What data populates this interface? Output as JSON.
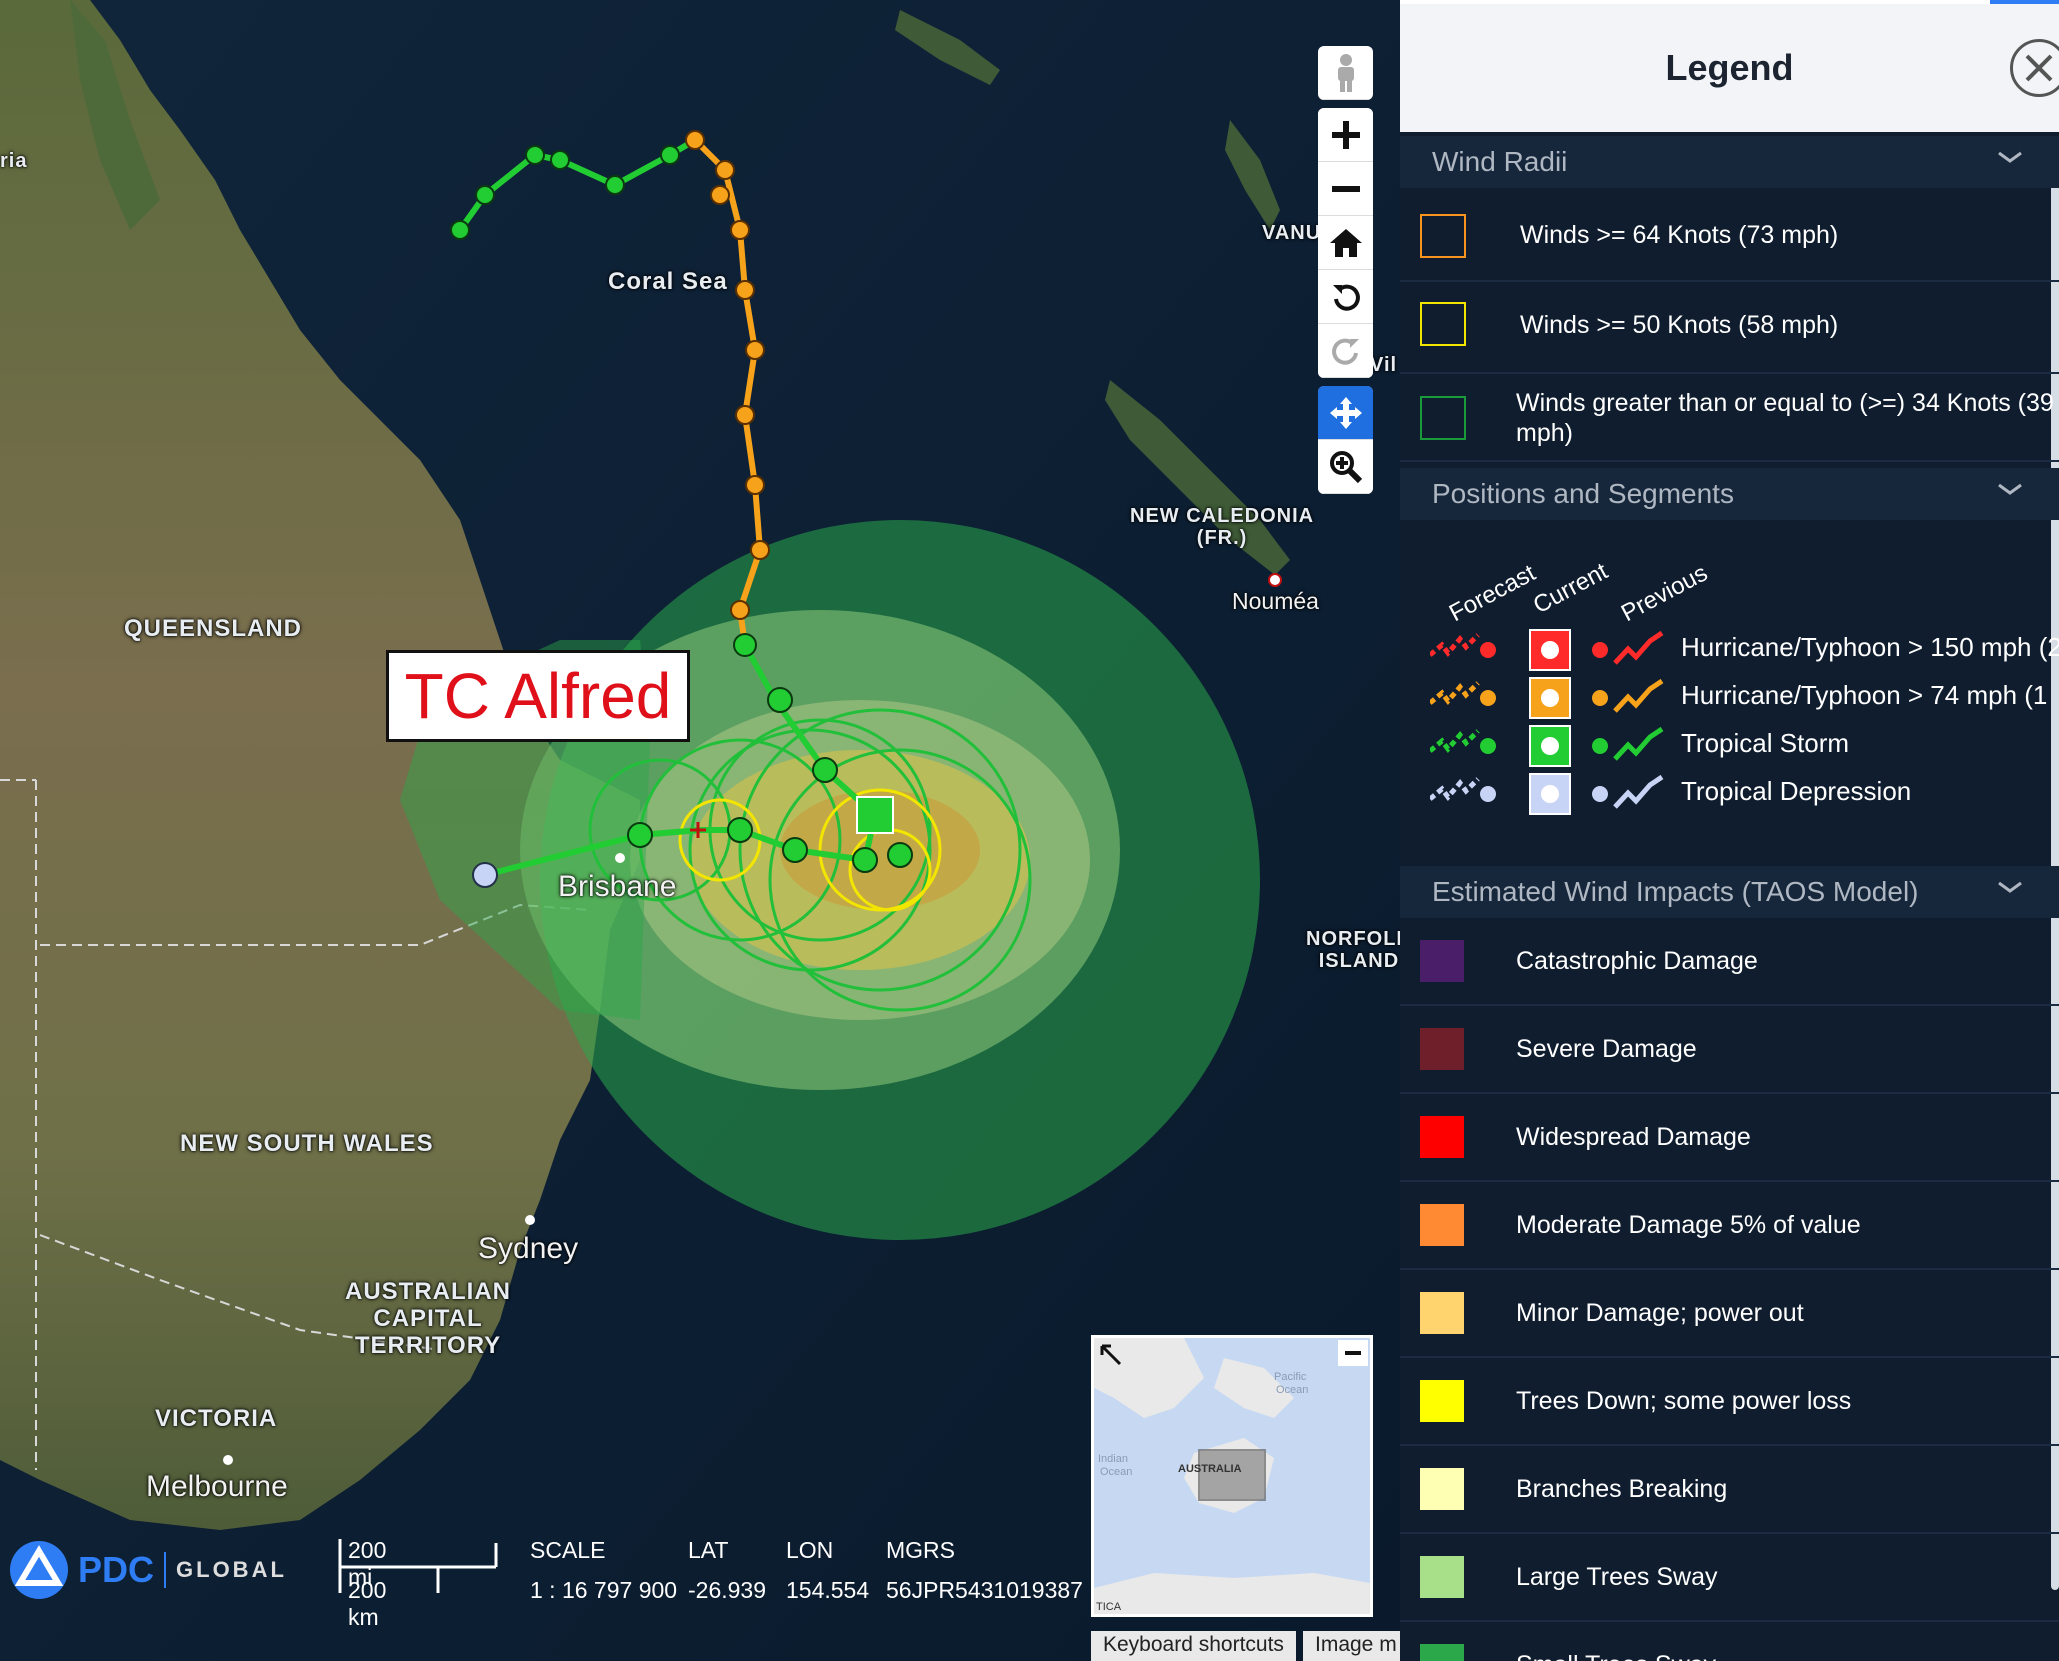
{
  "map": {
    "region_labels": {
      "queensland": "QUEENSLAND",
      "new_south_wales": "NEW SOUTH WALES",
      "act": [
        "AUSTRALIAN",
        "CAPITAL",
        "TERRITORY"
      ],
      "victoria": "VICTORIA",
      "new_caledonia": [
        "NEW CALEDONIA",
        "(FR.)"
      ],
      "norfolk_island": [
        "NORFOLK",
        "ISLAND"
      ],
      "vanuatu": "VANUATU",
      "coral_sea": "Coral Sea",
      "australia_edge": "ria",
      "vi_edge": "Vil"
    },
    "city_labels": {
      "brisbane": "Brisbane",
      "sydney": "Sydney",
      "melbourne": "Melbourne",
      "noumea": "Nouméa"
    },
    "storm_label": "TC Alfred"
  },
  "toolbar": {
    "street_view": "street-view-icon",
    "zoom_in": "plus-icon",
    "zoom_out": "minus-icon",
    "home": "home-icon",
    "rotate_left": "rotate-left-icon",
    "rotate_right": "rotate-right-icon",
    "pan": "pan-icon",
    "zoom_box": "magnifier-icon"
  },
  "bottom_bar": {
    "logo_text": "PDC",
    "logo_sub": "GLOBAL",
    "scale_mi": "200 mi",
    "scale_km": "200 km",
    "headers": {
      "scale": "SCALE",
      "lat": "LAT",
      "lon": "LON",
      "mgrs": "MGRS"
    },
    "values": {
      "scale": "1 : 16 797 900",
      "lat": "-26.939",
      "lon": "154.554",
      "mgrs": "56JPR5431019387"
    }
  },
  "overview": {
    "labels": {
      "pacific": [
        "Pacific",
        "Ocean"
      ],
      "indian": [
        "Indian",
        "Ocean"
      ],
      "australia": "AUSTRALIA",
      "antarctica": "TICA"
    }
  },
  "footer": {
    "keyboard_shortcuts": "Keyboard shortcuts",
    "image_m": "Image m"
  },
  "legend": {
    "title": "Legend",
    "sections": {
      "wind_radii": {
        "title": "Wind Radii",
        "items": [
          {
            "label": "Winds >= 64 Knots (73 mph)",
            "color": "#f7941d"
          },
          {
            "label": "Winds >= 50 Knots (58 mph)",
            "color": "#f2e600"
          },
          {
            "label_line1": "Winds greater than or equal to (>=) 34 Knots (39",
            "label_line2": "mph)",
            "color": "#1a9a3a"
          }
        ]
      },
      "positions": {
        "title": "Positions and Segments",
        "columns": [
          "Forecast",
          "Current",
          "Previous"
        ],
        "items": [
          {
            "label": "Hurricane/Typhoon > 150 mph (2",
            "color": "#ff2a2a"
          },
          {
            "label": "Hurricane/Typhoon > 74 mph (1",
            "color": "#f7a21b"
          },
          {
            "label": "Tropical Storm",
            "color": "#22cc33"
          },
          {
            "label": "Tropical Depression",
            "color": "#c8d4f5"
          }
        ]
      },
      "wind_impacts": {
        "title": "Estimated Wind Impacts (TAOS Model)",
        "items": [
          {
            "label": "Catastrophic Damage",
            "color": "#4a1e68"
          },
          {
            "label": "Severe Damage",
            "color": "#6e1f2a"
          },
          {
            "label": "Widespread Damage",
            "color": "#ff0000"
          },
          {
            "label": "Moderate Damage 5% of value",
            "color": "#ff8a33"
          },
          {
            "label": "Minor Damage; power out",
            "color": "#ffd36e"
          },
          {
            "label": "Trees Down; some power loss",
            "color": "#ffff00"
          },
          {
            "label": "Branches Breaking",
            "color": "#ffffb3"
          },
          {
            "label": "Large Trees Sway",
            "color": "#a8e08a"
          },
          {
            "label": "Small Trees Sway",
            "color": "#2aa84a"
          }
        ]
      }
    }
  }
}
